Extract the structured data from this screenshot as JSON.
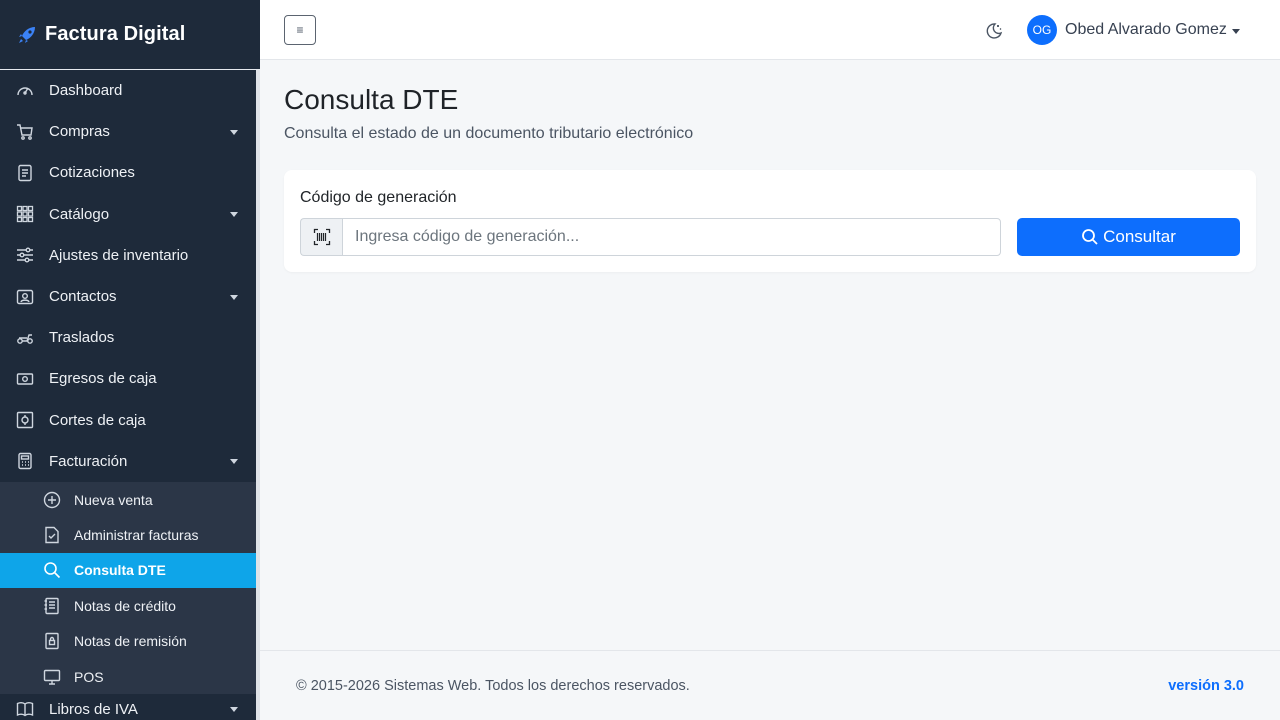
{
  "brand": {
    "title": "Factura Digital",
    "icon": "rocket-icon",
    "accent": "#0d6efd"
  },
  "sidebar": {
    "items": [
      {
        "label": "Dashboard",
        "icon": "speedometer-icon",
        "has_submenu": false
      },
      {
        "label": "Compras",
        "icon": "cart-icon",
        "has_submenu": true
      },
      {
        "label": "Cotizaciones",
        "icon": "document-icon",
        "has_submenu": false
      },
      {
        "label": "Catálogo",
        "icon": "grid-icon",
        "has_submenu": true
      },
      {
        "label": "Ajustes de inventario",
        "icon": "sliders-icon",
        "has_submenu": false
      },
      {
        "label": "Contactos",
        "icon": "contact-card-icon",
        "has_submenu": true
      },
      {
        "label": "Traslados",
        "icon": "scooter-icon",
        "has_submenu": false
      },
      {
        "label": "Egresos de caja",
        "icon": "cash-icon",
        "has_submenu": false
      },
      {
        "label": "Cortes de caja",
        "icon": "safe-icon",
        "has_submenu": false
      },
      {
        "label": "Facturación",
        "icon": "calculator-icon",
        "has_submenu": true,
        "expanded": true
      }
    ],
    "facturacion_sub": [
      {
        "label": "Nueva venta",
        "icon": "plus-circle-icon",
        "active": false
      },
      {
        "label": "Administrar facturas",
        "icon": "file-check-icon",
        "active": false
      },
      {
        "label": "Consulta DTE",
        "icon": "search-icon",
        "active": true
      },
      {
        "label": "Notas de crédito",
        "icon": "journal-icon",
        "active": false
      },
      {
        "label": "Notas de remisión",
        "icon": "file-lock-icon",
        "active": false
      },
      {
        "label": "POS",
        "icon": "monitor-icon",
        "active": false
      }
    ],
    "last_item": {
      "label": "Libros de IVA",
      "icon": "book-icon",
      "has_submenu": true
    },
    "active_color": "#0ea5e9",
    "bg_color": "#1e2a3a"
  },
  "topbar": {
    "toggle_symbol": "≡",
    "theme_icon": "moon-icon",
    "user": {
      "initials": "OG",
      "name": "Obed Alvarado Gomez"
    }
  },
  "main": {
    "title": "Consulta DTE",
    "subtitle": "Consulta el estado de un documento tributario electrónico",
    "form": {
      "label": "Código de generación",
      "addon_icon": "barcode-icon",
      "value": "",
      "placeholder": "Ingresa código de generación...",
      "submit_label": "Consultar"
    }
  },
  "footer": {
    "copyright": "© 2015-2026 Sistemas Web. Todos los derechos reservados.",
    "version": "versión 3.0"
  }
}
